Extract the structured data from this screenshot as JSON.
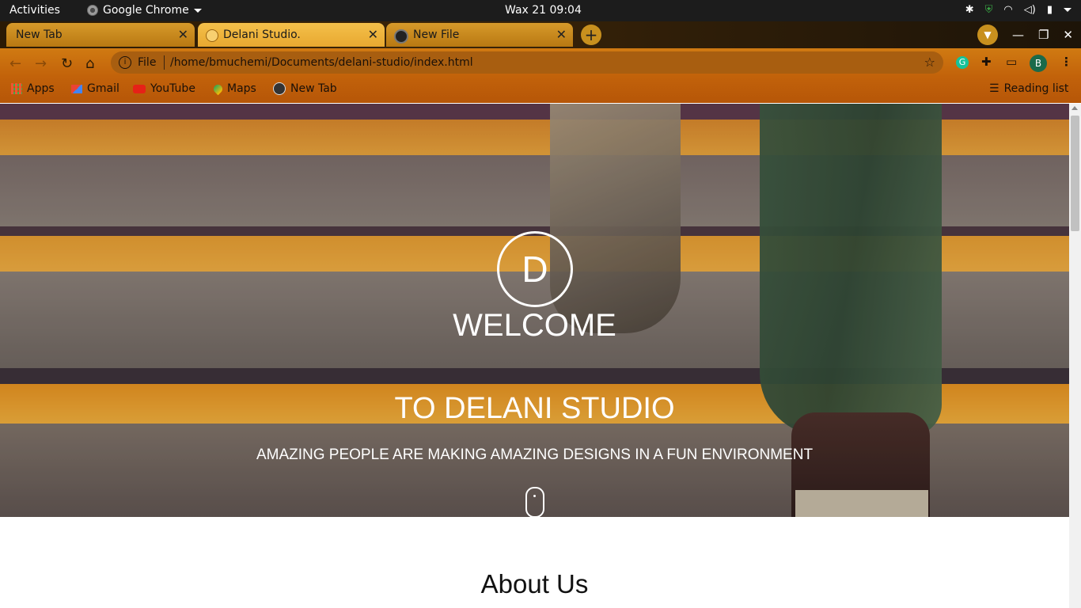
{
  "system_bar": {
    "activities": "Activities",
    "app_name": "Google Chrome",
    "clock": "Wax 21  09:04"
  },
  "tabs": [
    {
      "title": "New Tab",
      "active": false
    },
    {
      "title": "Delani Studio.",
      "active": true
    },
    {
      "title": "New File",
      "active": false
    }
  ],
  "toolbar": {
    "scheme": "File",
    "url": "/home/bmuchemi/Documents/delani-studio/index.html",
    "profile_initial": "B"
  },
  "bookmarks": [
    {
      "label": "Apps",
      "icon": "apps-grid-icon"
    },
    {
      "label": "Gmail",
      "icon": "gmail-icon"
    },
    {
      "label": "YouTube",
      "icon": "youtube-icon"
    },
    {
      "label": "Maps",
      "icon": "maps-icon"
    },
    {
      "label": "New Tab",
      "icon": "globe-icon"
    }
  ],
  "reading_list": "Reading list",
  "page": {
    "logo_letter": "D",
    "welcome": "WELCOME",
    "studio": "TO DELANI STUDIO",
    "tagline": "AMAZING PEOPLE ARE MAKING AMAZING DESIGNS IN A FUN ENVIRONMENT",
    "about_heading": "About Us"
  },
  "colors": {
    "tab_active": "#f4c04a",
    "toolbar": "#c96e0e",
    "stripe_yellow": "#f0a52a"
  }
}
